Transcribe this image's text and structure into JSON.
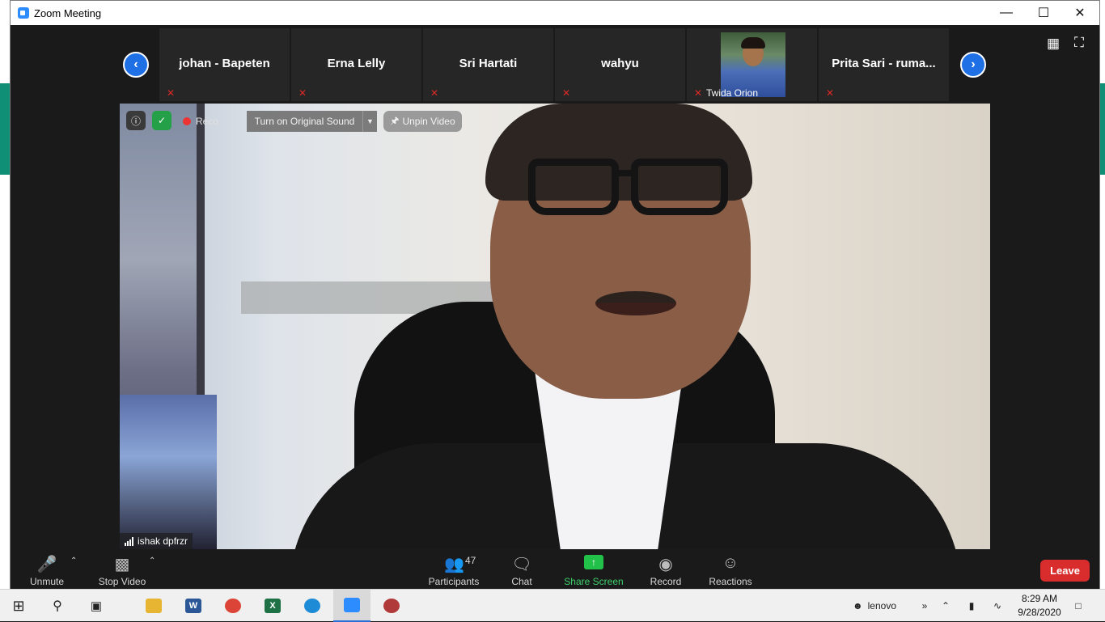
{
  "window": {
    "title": "Zoom Meeting"
  },
  "titlebar": {
    "minimize_icon": "minimize-icon",
    "maximize_icon": "maximize-icon",
    "close_icon": "close-icon"
  },
  "strip": {
    "participants": [
      {
        "name": "johan - Bapeten",
        "muted": true
      },
      {
        "name": "Erna Lelly",
        "muted": true
      },
      {
        "name": "Sri Hartati",
        "muted": true
      },
      {
        "name": "wahyu",
        "muted": true
      },
      {
        "name": "Twida Orion",
        "muted": true,
        "has_video": true
      },
      {
        "name": "Prita Sari - ruma...",
        "muted": true
      }
    ],
    "prev_icon": "chevron-left-icon",
    "next_icon": "chevron-right-icon"
  },
  "video": {
    "recording_label": "Reco",
    "original_sound_label": "Turn on Original Sound",
    "unpin_label": "Unpin Video",
    "speaker_name": "ishak dpfrzr"
  },
  "toolbar": {
    "unmute_label": "Unmute",
    "stop_video_label": "Stop Video",
    "participants_label": "Participants",
    "participants_count": "47",
    "chat_label": "Chat",
    "share_screen_label": "Share Screen",
    "record_label": "Record",
    "reactions_label": "Reactions",
    "leave_label": "Leave",
    "share_color": "#22c24a",
    "leave_color": "#d92d2d"
  },
  "taskbar": {
    "user_label": "lenovo",
    "time": "8:29 AM",
    "date": "9/28/2020"
  }
}
